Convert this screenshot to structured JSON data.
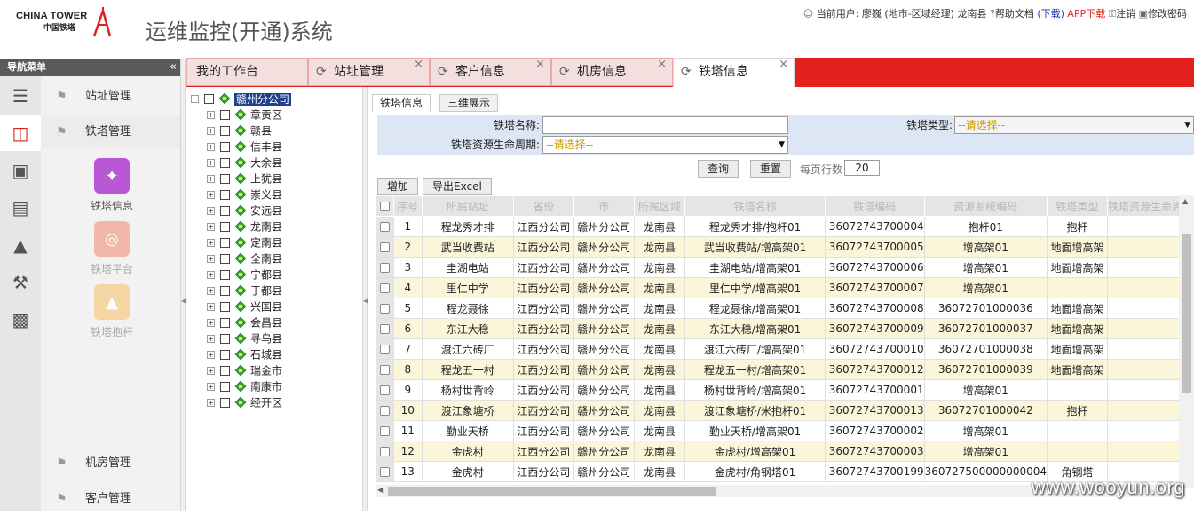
{
  "brand": {
    "logo_en": "CHINA TOWER",
    "logo_cn": "中国铁塔",
    "accent": "#e3201b"
  },
  "app_title": "运维监控(开通)系统",
  "user_bar": {
    "user_label": "当前用户:",
    "user_name": "廖巍 (地市-区域经理)",
    "county": "龙南县",
    "help": "帮助文档",
    "download": "(下载)",
    "app_download": "APP下载",
    "logout": "注销",
    "change_password": "修改密码"
  },
  "nav": {
    "header": "导航菜单",
    "collapse": "«",
    "sections": [
      {
        "label": "站址管理"
      },
      {
        "label": "铁塔管理"
      },
      {
        "label": "机房管理"
      },
      {
        "label": "客户管理"
      }
    ],
    "sub_items": [
      {
        "label": "铁塔信息",
        "enabled": true
      },
      {
        "label": "铁塔平台",
        "enabled": false
      },
      {
        "label": "铁塔抱杆",
        "enabled": false
      }
    ]
  },
  "tabs": [
    {
      "label": "我的工作台"
    },
    {
      "label": "站址管理"
    },
    {
      "label": "客户信息"
    },
    {
      "label": "机房信息"
    },
    {
      "label": "铁塔信息"
    }
  ],
  "tree": {
    "root": "赣州分公司",
    "children": [
      "章贡区",
      "赣县",
      "信丰县",
      "大余县",
      "上犹县",
      "崇义县",
      "安远县",
      "龙南县",
      "定南县",
      "全南县",
      "宁都县",
      "于都县",
      "兴国县",
      "会昌县",
      "寻乌县",
      "石城县",
      "瑞金市",
      "南康市",
      "经开区"
    ]
  },
  "subtabs": [
    {
      "label": "铁塔信息"
    },
    {
      "label": "三维展示"
    }
  ],
  "form": {
    "tower_name_label": "铁塔名称:",
    "tower_name_value": "",
    "tower_type_label": "铁塔类型:",
    "tower_type_value": "--请选择--",
    "lifecycle_label": "铁塔资源生命周期:",
    "lifecycle_value": "--请选择--"
  },
  "actions": {
    "query": "查询",
    "reset": "重置",
    "page_size_label": "每页行数",
    "page_size": "20",
    "add": "增加",
    "export": "导出Excel"
  },
  "table": {
    "columns": [
      "序号",
      "所属站址",
      "省份",
      "市",
      "所属区域",
      "铁塔名称",
      "铁塔编码",
      "资源系统编码",
      "铁塔类型",
      "铁塔资源生命周期"
    ],
    "rows": [
      [
        "1",
        "程龙秀才排",
        "江西分公司",
        "赣州分公司",
        "龙南县",
        "程龙秀才排/抱杆01",
        "36072743700004",
        "抱杆01",
        "抱杆",
        ""
      ],
      [
        "2",
        "武当收费站",
        "江西分公司",
        "赣州分公司",
        "龙南县",
        "武当收费站/增高架01",
        "36072743700005",
        "增高架01",
        "地面增高架",
        ""
      ],
      [
        "3",
        "圭湖电站",
        "江西分公司",
        "赣州分公司",
        "龙南县",
        "圭湖电站/增高架01",
        "36072743700006",
        "增高架01",
        "地面增高架",
        ""
      ],
      [
        "4",
        "里仁中学",
        "江西分公司",
        "赣州分公司",
        "龙南县",
        "里仁中学/增高架01",
        "36072743700007",
        "增高架01",
        "",
        ""
      ],
      [
        "5",
        "程龙聂徐",
        "江西分公司",
        "赣州分公司",
        "龙南县",
        "程龙聂徐/增高架01",
        "36072743700008",
        "36072701000036",
        "地面增高架",
        ""
      ],
      [
        "6",
        "东江大稳",
        "江西分公司",
        "赣州分公司",
        "龙南县",
        "东江大稳/增高架01",
        "36072743700009",
        "36072701000037",
        "地面增高架",
        ""
      ],
      [
        "7",
        "渡江六砖厂",
        "江西分公司",
        "赣州分公司",
        "龙南县",
        "渡江六砖厂/增高架01",
        "36072743700010",
        "36072701000038",
        "地面增高架",
        ""
      ],
      [
        "8",
        "程龙五一村",
        "江西分公司",
        "赣州分公司",
        "龙南县",
        "程龙五一村/增高架01",
        "36072743700012",
        "36072701000039",
        "地面增高架",
        ""
      ],
      [
        "9",
        "杨村世背岭",
        "江西分公司",
        "赣州分公司",
        "龙南县",
        "杨村世背岭/增高架01",
        "36072743700001",
        "增高架01",
        "",
        ""
      ],
      [
        "10",
        "渡江象塘桥",
        "江西分公司",
        "赣州分公司",
        "龙南县",
        "渡江象塘桥/米抱杆01",
        "36072743700013",
        "36072701000042",
        "抱杆",
        ""
      ],
      [
        "11",
        "勤业天桥",
        "江西分公司",
        "赣州分公司",
        "龙南县",
        "勤业天桥/增高架01",
        "36072743700002",
        "增高架01",
        "",
        ""
      ],
      [
        "12",
        "金虎村",
        "江西分公司",
        "赣州分公司",
        "龙南县",
        "金虎村/增高架01",
        "36072743700003",
        "增高架01",
        "",
        ""
      ],
      [
        "13",
        "金虎村",
        "江西分公司",
        "赣州分公司",
        "龙南县",
        "金虎村/角钢塔01",
        "36072743700199",
        "360727500000000004",
        "角钢塔",
        ""
      ]
    ]
  },
  "watermark": "www.wooyun.org"
}
